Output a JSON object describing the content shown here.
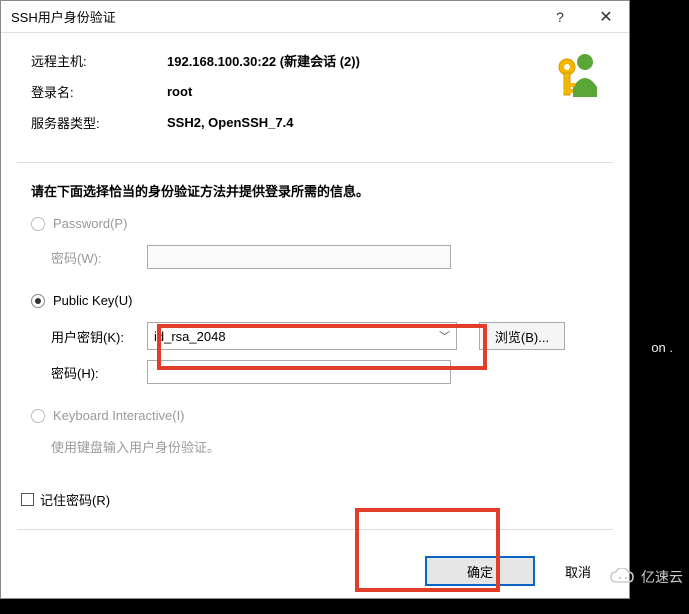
{
  "titlebar": {
    "title": "SSH用户身份验证",
    "help": "?",
    "close": "✕"
  },
  "info": {
    "remote_host_label": "远程主机:",
    "remote_host_value": "192.168.100.30:22 (新建会话 (2))",
    "login_name_label": "登录名:",
    "login_name_value": "root",
    "server_type_label": "服务器类型:",
    "server_type_value": "SSH2, OpenSSH_7.4"
  },
  "instruction": "请在下面选择恰当的身份验证方法并提供登录所需的信息。",
  "password": {
    "label": "Password(P)",
    "field_label": "密码(W):"
  },
  "pubkey": {
    "label": "Public Key(U)",
    "user_key_label": "用户密钥(K):",
    "user_key_value": "id_rsa_2048",
    "browse_label": "浏览(B)...",
    "passphrase_label": "密码(H):"
  },
  "kbi": {
    "label": "Keyboard Interactive(I)",
    "hint": "使用键盘输入用户身份验证。"
  },
  "remember": {
    "label": "记住密码(R)"
  },
  "buttons": {
    "ok": "确定",
    "cancel": "取消"
  },
  "background_fragment": "on .",
  "watermark": "亿速云"
}
